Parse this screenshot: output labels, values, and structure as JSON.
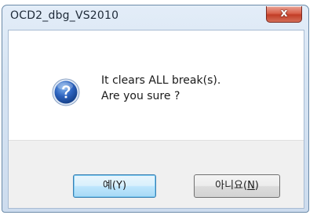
{
  "window": {
    "title": "OCD2_dbg_VS2010",
    "close_glyph": "x"
  },
  "message": {
    "icon": "question-icon",
    "line1": "It clears ALL break(s).",
    "line2": "Are you sure ?"
  },
  "buttons": {
    "yes_label": "예(Y)",
    "no_prefix": "아니요(",
    "no_mnemonic": "N",
    "no_suffix": ")"
  },
  "colors": {
    "icon_blue": "#2a5db0",
    "close_red": "#c23d26",
    "default_button_border": "#3c7fb1"
  }
}
